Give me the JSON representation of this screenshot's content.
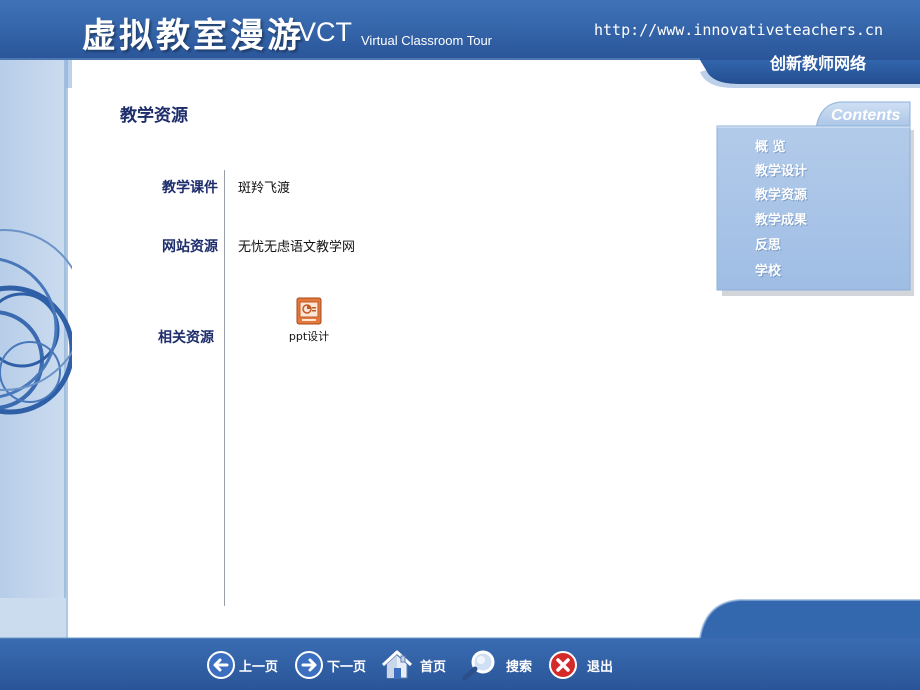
{
  "header": {
    "app_title": "虚拟教室漫游",
    "app_abbr": "VCT",
    "app_subtitle": "Virtual Classroom Tour",
    "site_url": "http://www.innovativeteachers.cn",
    "site_name": "创新教师网络"
  },
  "page": {
    "title": "教学资源",
    "rows": [
      {
        "label": "教学课件",
        "value": "斑羚飞渡"
      },
      {
        "label": "网站资源",
        "value": "无忧无虑语文教学网"
      },
      {
        "label": "相关资源",
        "file_label": "ppt设计",
        "file_icon": "powerpoint-file-icon"
      }
    ]
  },
  "contents": {
    "title": "Contents",
    "items": [
      "概 览",
      "教学设计",
      "教学资源",
      "教学成果",
      "反思",
      "学校"
    ]
  },
  "footer": {
    "nav": [
      {
        "label": "上一页",
        "icon": "arrow-left-icon"
      },
      {
        "label": "下一页",
        "icon": "arrow-right-icon"
      },
      {
        "label": "首页",
        "icon": "home-icon"
      },
      {
        "label": "搜索",
        "icon": "magnifier-icon"
      },
      {
        "label": "退出",
        "icon": "close-icon"
      }
    ]
  },
  "colors": {
    "brand_blue": "#2f5fa6",
    "light_blue": "#bcd1ea",
    "panel_blue": "#a8c4e6",
    "heading_navy": "#1d2d6b"
  }
}
